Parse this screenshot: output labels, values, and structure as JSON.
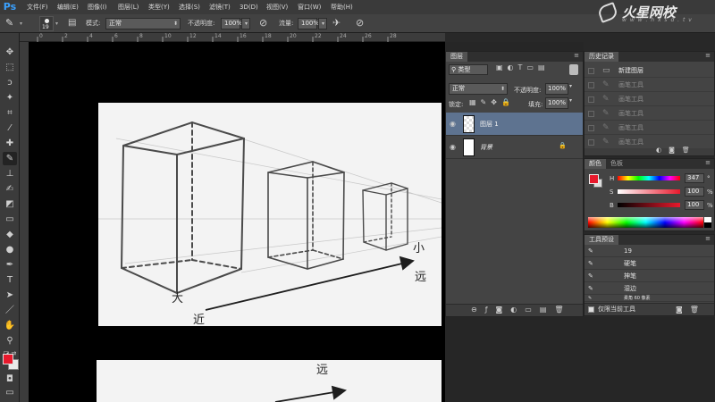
{
  "app": {
    "logo": "Ps",
    "window_controls": "– □ ✕"
  },
  "menu": [
    "文件(F)",
    "编辑(E)",
    "图像(I)",
    "图层(L)",
    "类型(Y)",
    "选择(S)",
    "滤镜(T)",
    "3D(D)",
    "视图(V)",
    "窗口(W)",
    "帮助(H)"
  ],
  "brand": {
    "name": "火星网校",
    "url": "w w w . h x s d . t v"
  },
  "options": {
    "brush_size": "19",
    "mode_label": "模式:",
    "mode_value": "正常",
    "opacity_label": "不透明度:",
    "opacity_value": "100%",
    "flow_label": "流量:",
    "flow_value": "100%"
  },
  "ruler_ticks": [
    "0",
    "2",
    "4",
    "6",
    "8",
    "10",
    "12",
    "14",
    "16",
    "18",
    "20",
    "22",
    "24",
    "26",
    "28"
  ],
  "layers_panel": {
    "tab": "图层",
    "filter_kind": "类型",
    "blend_mode": "正常",
    "opacity_label": "不透明度:",
    "opacity_value": "100%",
    "lock_label": "锁定:",
    "fill_label": "填充:",
    "fill_value": "100%",
    "layers": [
      {
        "name": "图层 1",
        "selected": true
      },
      {
        "name": "背景",
        "selected": false,
        "locked": true
      }
    ]
  },
  "history_panel": {
    "tab": "历史记录",
    "items": [
      "新建图层",
      "画笔工具",
      "画笔工具",
      "画笔工具",
      "画笔工具",
      "画笔工具"
    ]
  },
  "color_panel": {
    "tabs": [
      "颜色",
      "色板"
    ],
    "h": {
      "label": "H",
      "value": "347",
      "unit": "°"
    },
    "s": {
      "label": "S",
      "value": "100",
      "unit": "%"
    },
    "b": {
      "label": "B",
      "value": "100",
      "unit": "%"
    },
    "foreground": "#e8192c"
  },
  "presets_panel": {
    "tab": "工具预设",
    "items": [
      "19",
      "硬笔",
      "抻笔",
      "湿边",
      "柔角 60 像素"
    ],
    "current_only_label": "仅限当前工具"
  },
  "drawing": {
    "label_big": "大",
    "label_near": "近",
    "label_small": "小",
    "label_far": "远",
    "label_far2": "远"
  }
}
